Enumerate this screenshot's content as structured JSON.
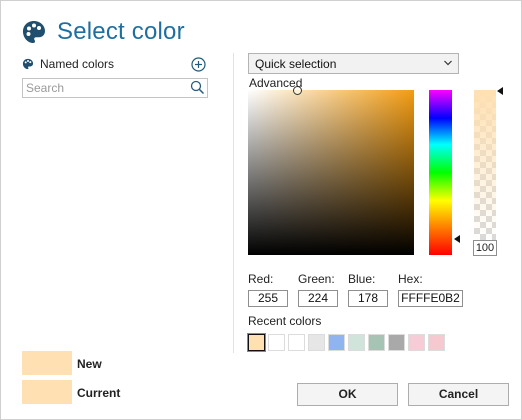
{
  "dialog": {
    "title": "Select color",
    "title_icon": "palette-icon"
  },
  "named_colors": {
    "label": "Named colors",
    "label_icon": "palette-icon",
    "add_icon": "add-circle-icon",
    "search": {
      "placeholder": "Search",
      "value": "",
      "icon": "search-icon"
    }
  },
  "picker": {
    "mode": "Quick selection",
    "dropdown_icon": "chevron-down-icon",
    "advanced_label": "Advanced",
    "hue_color": "#f39c12",
    "alpha": "100",
    "red_label": "Red:",
    "green_label": "Green:",
    "blue_label": "Blue:",
    "hex_label": "Hex:",
    "red": "255",
    "green": "224",
    "blue": "178",
    "hex": "FFFFE0B2"
  },
  "recent": {
    "label": "Recent colors",
    "colors": [
      "#ffe0b2",
      "#ffffff",
      "#ffffff",
      "#e6e6e6",
      "#8fb4f0",
      "#d0e4dc",
      "#a7c3b4",
      "#a9a9a9",
      "#f6cdd6",
      "#f6c9d0"
    ],
    "selected_index": 0
  },
  "preview": {
    "new_label": "New",
    "current_label": "Current",
    "new_color": "#ffe0b2",
    "current_color": "#ffe0b2"
  },
  "buttons": {
    "ok": "OK",
    "cancel": "Cancel"
  },
  "colors": {
    "accent": "#1e6fa0"
  }
}
